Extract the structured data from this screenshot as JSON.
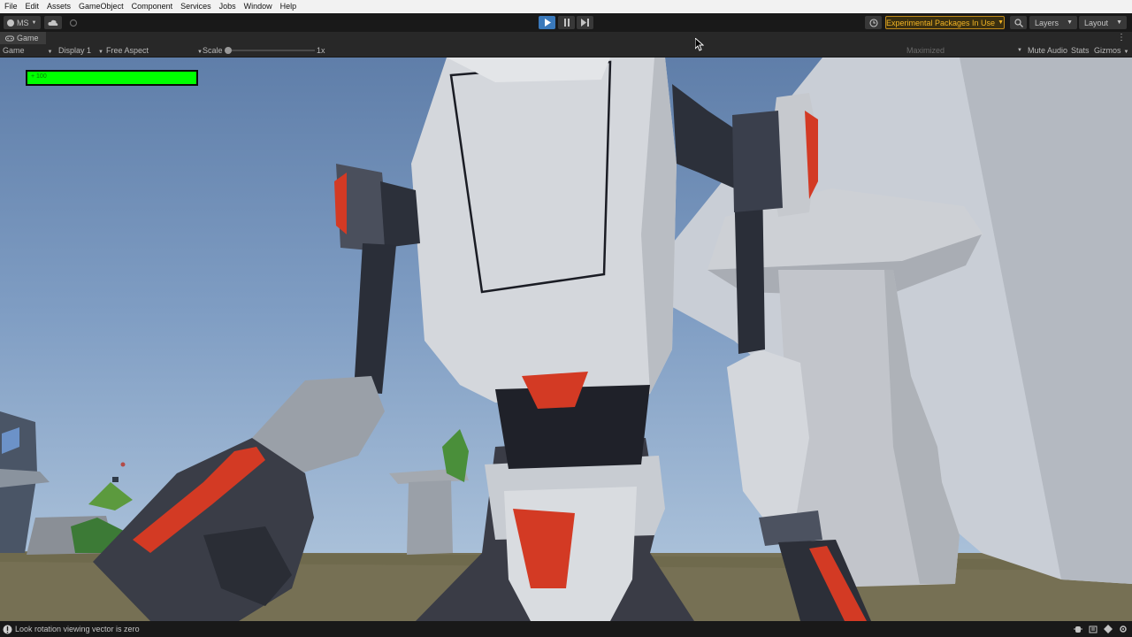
{
  "menu": [
    "File",
    "Edit",
    "Assets",
    "GameObject",
    "Component",
    "Services",
    "Jobs",
    "Window",
    "Help"
  ],
  "toolbar": {
    "account_label": "MS",
    "experimental_label": "Experimental Packages In Use",
    "layers_label": "Layers",
    "layout_label": "Layout"
  },
  "tab": {
    "label": "Game"
  },
  "game_toolbar": {
    "mode": "Game",
    "display": "Display 1",
    "aspect": "Free Aspect",
    "scale_label": "Scale",
    "scale_value": "1x",
    "maximized": "Maximized",
    "mute_audio": "Mute Audio",
    "stats": "Stats",
    "gizmos": "Gizmos"
  },
  "hud": {
    "health_text": "+ 100",
    "health_fraction": 1.0
  },
  "status": {
    "message": "Look rotation viewing vector is zero"
  },
  "colors": {
    "health_green": "#00ff00",
    "play_blue": "#3a79bb",
    "warning_amber": "#f2b324",
    "robot_accent": "#e0402a"
  }
}
